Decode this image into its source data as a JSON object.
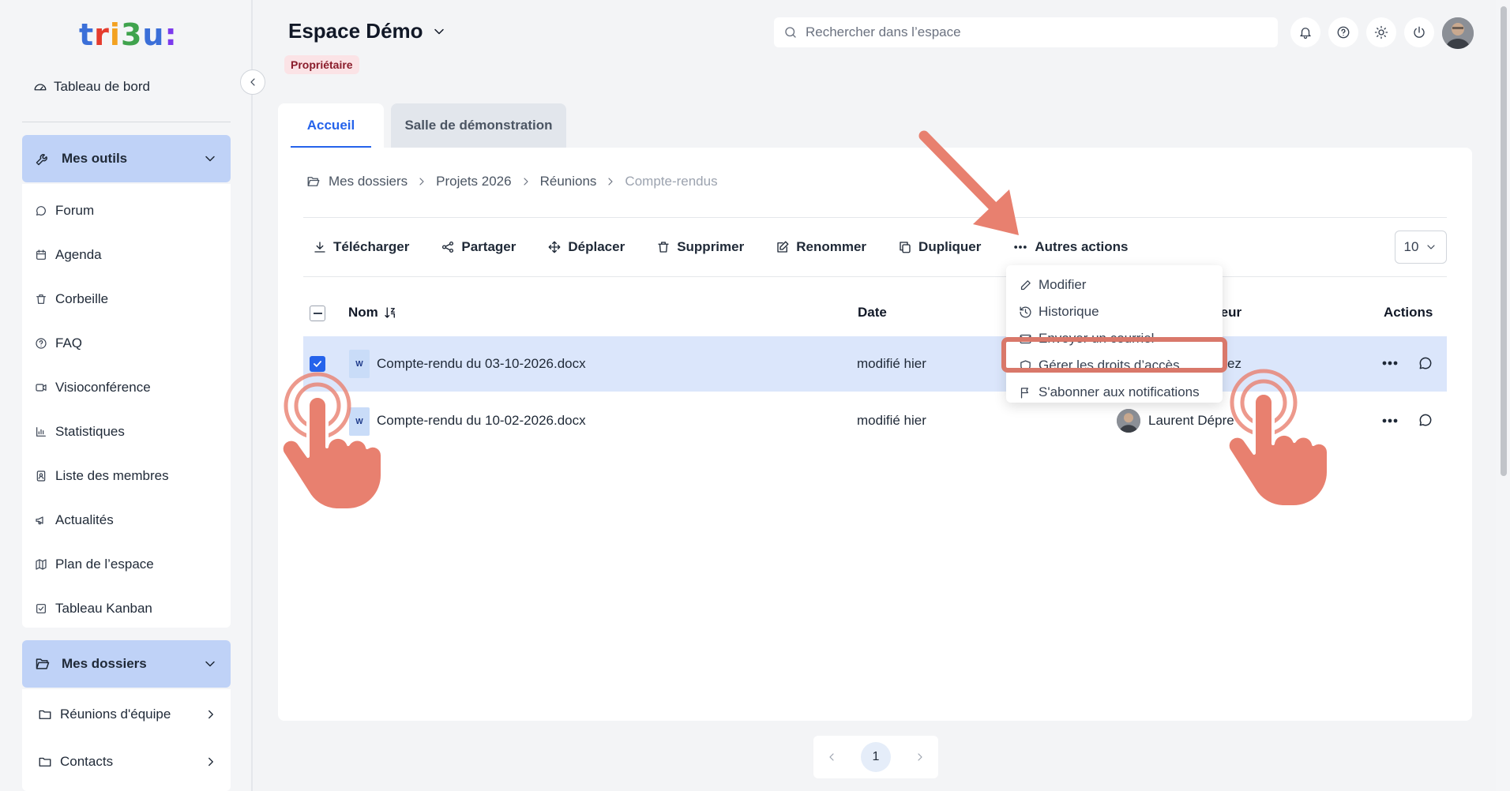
{
  "logo": {
    "parts": [
      "t",
      "r",
      "i",
      "3",
      "u",
      ":"
    ]
  },
  "sidebar": {
    "dashboard": "Tableau de bord",
    "tools": {
      "title": "Mes outils",
      "items": [
        {
          "label": "Forum",
          "icon": "chat-icon"
        },
        {
          "label": "Agenda",
          "icon": "calendar-icon"
        },
        {
          "label": "Corbeille",
          "icon": "trash-icon"
        },
        {
          "label": "FAQ",
          "icon": "help-icon"
        },
        {
          "label": "Visioconférence",
          "icon": "video-icon"
        },
        {
          "label": "Statistiques",
          "icon": "chart-icon"
        },
        {
          "label": "Liste des membres",
          "icon": "members-icon"
        },
        {
          "label": "Actualités",
          "icon": "megaphone-icon"
        },
        {
          "label": "Plan de l’espace",
          "icon": "map-icon"
        },
        {
          "label": "Tableau Kanban",
          "icon": "kanban-icon"
        }
      ]
    },
    "folders": {
      "title": "Mes dossiers",
      "items": [
        {
          "label": "Réunions d'équipe"
        },
        {
          "label": "Contacts"
        }
      ]
    }
  },
  "header": {
    "space_title": "Espace Démo",
    "role_badge": "Propriétaire",
    "search_placeholder": "Rechercher dans l’espace"
  },
  "tabs": [
    {
      "label": "Accueil",
      "active": true
    },
    {
      "label": "Salle de démonstration",
      "active": false
    }
  ],
  "breadcrumb": [
    "Mes dossiers",
    "Projets 2026",
    "Réunions",
    "Compte-rendus"
  ],
  "toolbar": {
    "download": "Télécharger",
    "share": "Partager",
    "move": "Déplacer",
    "delete": "Supprimer",
    "rename": "Renommer",
    "duplicate": "Dupliquer",
    "more": "Autres actions",
    "per_page": "10"
  },
  "table": {
    "columns": {
      "name": "Nom",
      "date": "Date",
      "author": "teur",
      "actions": "Actions"
    },
    "rows": [
      {
        "name": "Compte-rendu du 03-10-2026.docx",
        "date": "modifié hier",
        "author": "ez",
        "selected": true,
        "type_badge": "W"
      },
      {
        "name": "Compte-rendu du 10-02-2026.docx",
        "date": "modifié hier",
        "author": "Laurent Dépre",
        "selected": false,
        "type_badge": "W"
      }
    ]
  },
  "dropdown": {
    "items": [
      {
        "label": "Modifier",
        "icon": "pencil-icon"
      },
      {
        "label": "Historique",
        "icon": "history-icon"
      },
      {
        "label": "Envoyer un courriel",
        "icon": "mail-icon"
      },
      {
        "label": "Gérer les droits d’accès",
        "icon": "shield-icon"
      },
      {
        "label": "S'abonner aux notifications",
        "icon": "flag-icon"
      }
    ]
  },
  "pagination": {
    "current": "1"
  },
  "colors": {
    "accent": "#2563eb",
    "tools_header_bg": "#bfd2f7",
    "selected_row": "#dbe6fb",
    "annotation": "#e8806f",
    "badge_bg": "#fbe3e6",
    "badge_text": "#8a1c2b"
  }
}
